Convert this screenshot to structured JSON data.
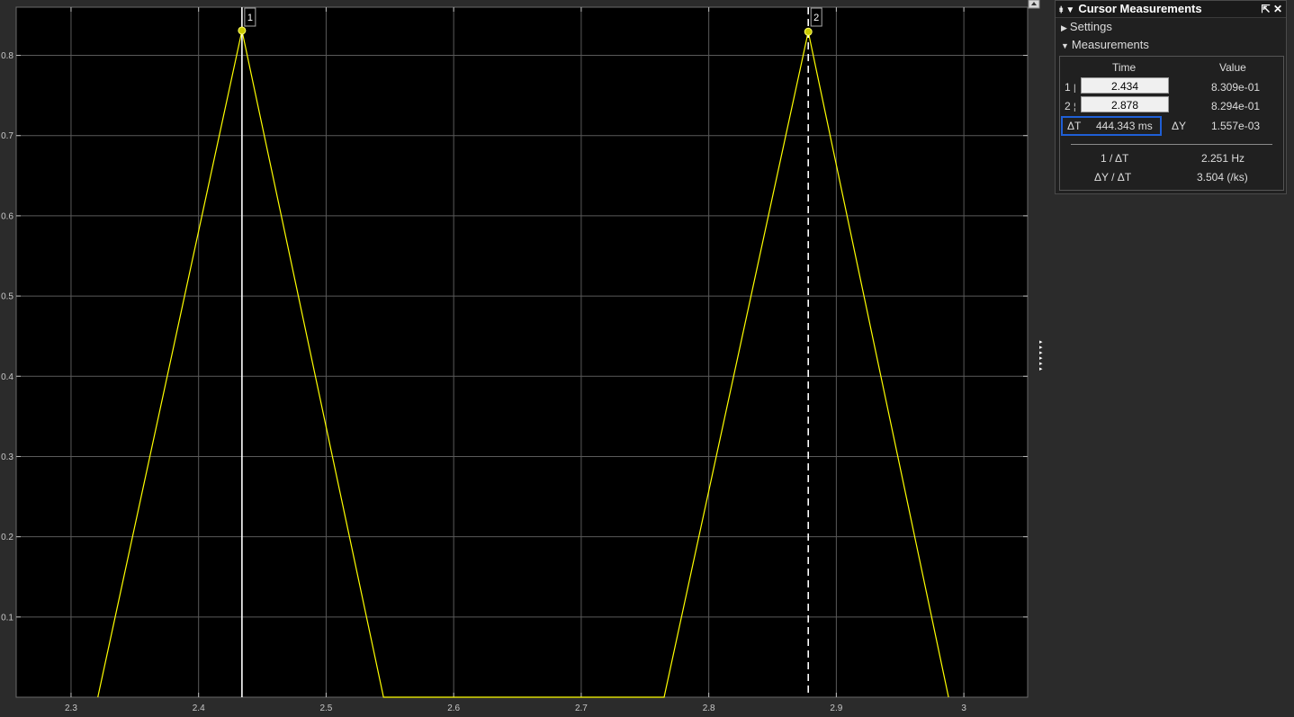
{
  "chart_data": {
    "type": "line",
    "xlim": [
      2.257,
      3.05
    ],
    "ylim": [
      0.0,
      0.86
    ],
    "x_ticks": [
      2.3,
      2.4,
      2.5,
      2.6,
      2.7,
      2.8,
      2.9,
      3.0
    ],
    "x_tick_labels": [
      "2.3",
      "2.4",
      "2.5",
      "2.6",
      "2.7",
      "2.8",
      "2.9",
      "3"
    ],
    "y_ticks": [
      0.1,
      0.2,
      0.3,
      0.4,
      0.5,
      0.6,
      0.7,
      0.8
    ],
    "y_tick_labels": [
      "0.1",
      "0.2",
      "0.3",
      "0.4",
      "0.5",
      "0.6",
      "0.7",
      "0.8"
    ],
    "grid": true,
    "background": "#000000",
    "line_color": "#ffff00",
    "series": [
      {
        "x": [
          2.321,
          2.434,
          2.545,
          2.765,
          2.878,
          2.988
        ],
        "y": [
          0.0,
          0.8309,
          0.0,
          0.0,
          0.8294,
          0.0
        ]
      }
    ],
    "cursors": [
      {
        "label": "1",
        "x": 2.434,
        "y": 0.8309,
        "style": "solid"
      },
      {
        "label": "2",
        "x": 2.878,
        "y": 0.8294,
        "style": "dashed"
      }
    ]
  },
  "panel": {
    "title": "Cursor Measurements",
    "settings_label": "Settings",
    "measurements_label": "Measurements",
    "col_time": "Time",
    "col_value": "Value",
    "rows": [
      {
        "label": "1",
        "time": "2.434",
        "value": "8.309e-01"
      },
      {
        "label": "2",
        "time": "2.878",
        "value": "8.294e-01"
      }
    ],
    "delta_t_label": "ΔT",
    "delta_t_value": "444.343 ms",
    "delta_y_label": "ΔY",
    "delta_y_value": "1.557e-03",
    "inv_dt_label": "1 / ΔT",
    "inv_dt_value": "2.251 Hz",
    "slope_label": "ΔY / ΔT",
    "slope_value": "3.504 (/ks)"
  },
  "colors": {
    "grid": "#5a5a5a",
    "cursor": "#ffffff",
    "highlight": "#1f5fd6"
  }
}
